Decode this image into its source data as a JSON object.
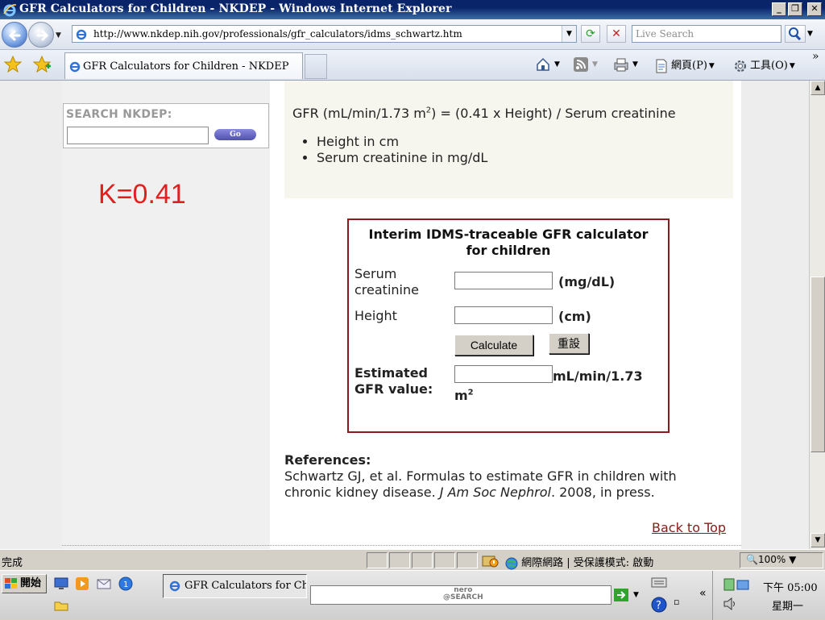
{
  "window": {
    "title": "GFR Calculators for Children - NKDEP - Windows Internet Explorer",
    "min_label": "_",
    "max_label": "❐",
    "close_label": "✕"
  },
  "navbar": {
    "url": "http://www.nkdep.nih.gov/professionals/gfr_calculators/idms_schwartz.htm",
    "search_placeholder": "Live Search"
  },
  "tabs": [
    {
      "label": "GFR Calculators for Children - NKDEP"
    }
  ],
  "command_bar": {
    "page_label": "網頁(P)",
    "tools_label": "工具(O)",
    "more": "»"
  },
  "sidebar": {
    "search_label": "SEARCH NKDEP:",
    "go_label": "Go"
  },
  "annotation": "K=0.41",
  "formula": {
    "prefix": "GFR (mL/min/1.73 m",
    "sup": "2",
    "suffix": ") = (0.41 x Height) / Serum creatinine",
    "bullets": [
      "Height in cm",
      "Serum creatinine in mg/dL"
    ]
  },
  "calculator": {
    "title_line1": "Interim IDMS-traceable GFR calculator",
    "title_line2": "for children",
    "serum_label_1": "Serum",
    "serum_label_2": "creatinine",
    "serum_unit": "(mg/dL)",
    "height_label": "Height",
    "height_unit": "(cm)",
    "calculate_label": "Calculate",
    "reset_label": "重設",
    "result_label_1": "Estimated",
    "result_label_2": "GFR value:",
    "result_unit_1": "mL/min/1.73",
    "result_unit_2": "m",
    "result_unit_sup": "2"
  },
  "references": {
    "heading": "References:",
    "text_1": "Schwartz GJ, et al. Formulas to estimate GFR in children with",
    "text_2": "chronic kidney disease. ",
    "journal": "J Am Soc Nephrol",
    "text_3": ". 2008, in press."
  },
  "back_to_top": "Back to Top",
  "status": {
    "text": "完成",
    "zone": "網際網路 | 受保護模式: 啟動",
    "zoom": "100%"
  },
  "taskbar": {
    "start_label": "開始",
    "task_label": "GFR Calculators for Ch...",
    "nero_line1": "nero",
    "nero_line2": "@SEARCH",
    "tray_collapse": "«",
    "time": "下午 05:00",
    "day": "星期一"
  },
  "colors": {
    "titlebar": "#0a246a",
    "annotation": "#e21f1f",
    "calc_border": "#8b1a1a",
    "link": "#8b1a1a"
  }
}
